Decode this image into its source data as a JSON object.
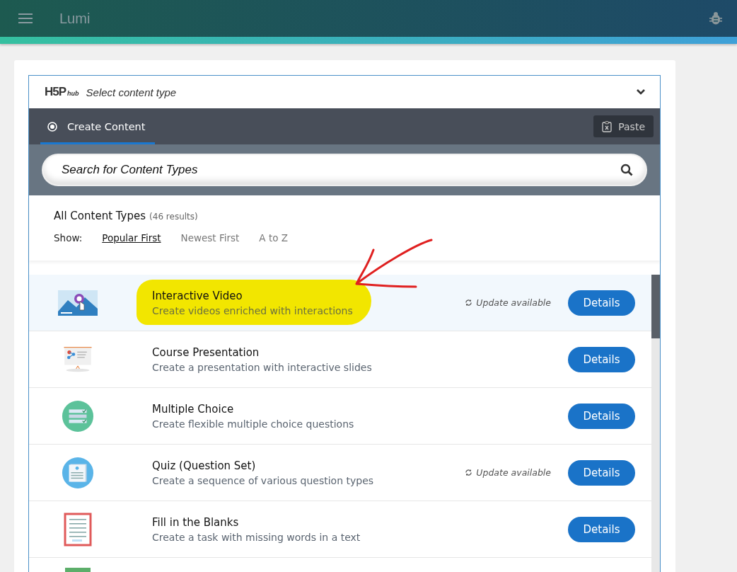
{
  "app_bar": {
    "title": "Lumi"
  },
  "hub": {
    "logo": {
      "main": "H5P",
      "sub": "hub"
    },
    "title": "Select content type",
    "expanded": true
  },
  "tabs": [
    {
      "label": "Create Content",
      "selected": true
    }
  ],
  "paste_button": "Paste",
  "search": {
    "placeholder": "Search for Content Types"
  },
  "results": {
    "heading": "All Content Types",
    "count": "(46 results)"
  },
  "sort": {
    "label": "Show:",
    "options": [
      {
        "label": "Popular First",
        "selected": true
      },
      {
        "label": "Newest First",
        "selected": false
      },
      {
        "label": "A to Z",
        "selected": false
      }
    ]
  },
  "content_types": [
    {
      "kind": "video",
      "title": "Interactive Video",
      "description": "Create videos enriched with interactions",
      "status": "Update available",
      "button": "Details",
      "selected": true,
      "highlighted": true
    },
    {
      "kind": "presentation",
      "title": "Course Presentation",
      "description": "Create a presentation with interactive slides",
      "button": "Details",
      "selected": false,
      "highlighted": false
    },
    {
      "kind": "choice",
      "title": "Multiple Choice",
      "description": "Create flexible multiple choice questions",
      "button": "Details",
      "selected": false,
      "highlighted": false
    },
    {
      "kind": "quiz",
      "title": "Quiz (Question Set)",
      "description": "Create a sequence of various question types",
      "status": "Update available",
      "button": "Details",
      "selected": false,
      "highlighted": false
    },
    {
      "kind": "blanks",
      "title": "Fill in the Blanks",
      "description": "Create a task with missing words in a text",
      "button": "Details",
      "selected": false,
      "highlighted": false
    },
    {
      "kind": "sheet",
      "selected": false
    }
  ]
}
